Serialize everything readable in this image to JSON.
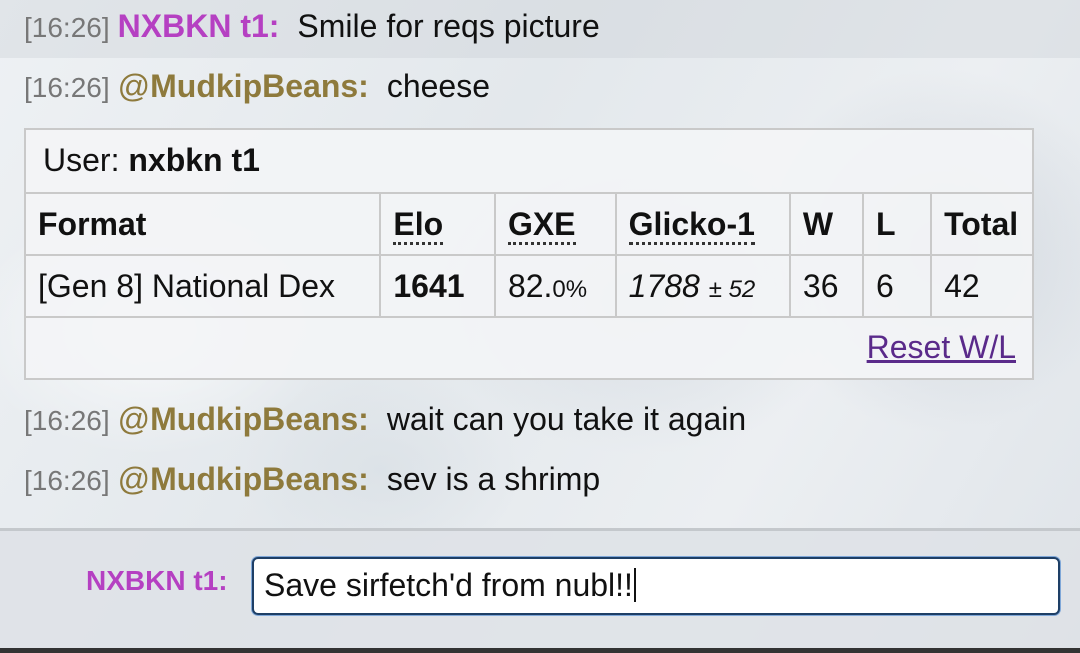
{
  "messages": [
    {
      "time": "[16:26]",
      "user": "NXBKN t1:",
      "text": "Smile for reqs picture"
    },
    {
      "time": "[16:26]",
      "at": "@",
      "user": "MudkipBeans:",
      "text": "cheese"
    },
    {
      "time": "[16:26]",
      "at": "@",
      "user": "MudkipBeans:",
      "text": "wait can you take it again"
    },
    {
      "time": "[16:26]",
      "at": "@",
      "user": "MudkipBeans:",
      "text": "sev is a shrimp"
    }
  ],
  "ladder": {
    "user_label": "User:",
    "user_name": "nxbkn t1",
    "headers": [
      "Format",
      "Elo",
      "GXE",
      "Glicko-1",
      "W",
      "L",
      "Total"
    ],
    "row": {
      "format": "[Gen 8] National Dex",
      "elo": "1641",
      "gxe_main": "82.",
      "gxe_small": "0%",
      "glicko_main": "1788",
      "glicko_small": "± 52",
      "w": "36",
      "l": "6",
      "total": "42"
    },
    "reset_label": "Reset W/L"
  },
  "composer": {
    "label": "NXBKN t1:",
    "value": "Save sirfetch'd from nubl!!"
  },
  "colors": {
    "nxbkn": "#b540c2",
    "mudkip": "#8e7a3c",
    "link": "#5a2a8a"
  }
}
